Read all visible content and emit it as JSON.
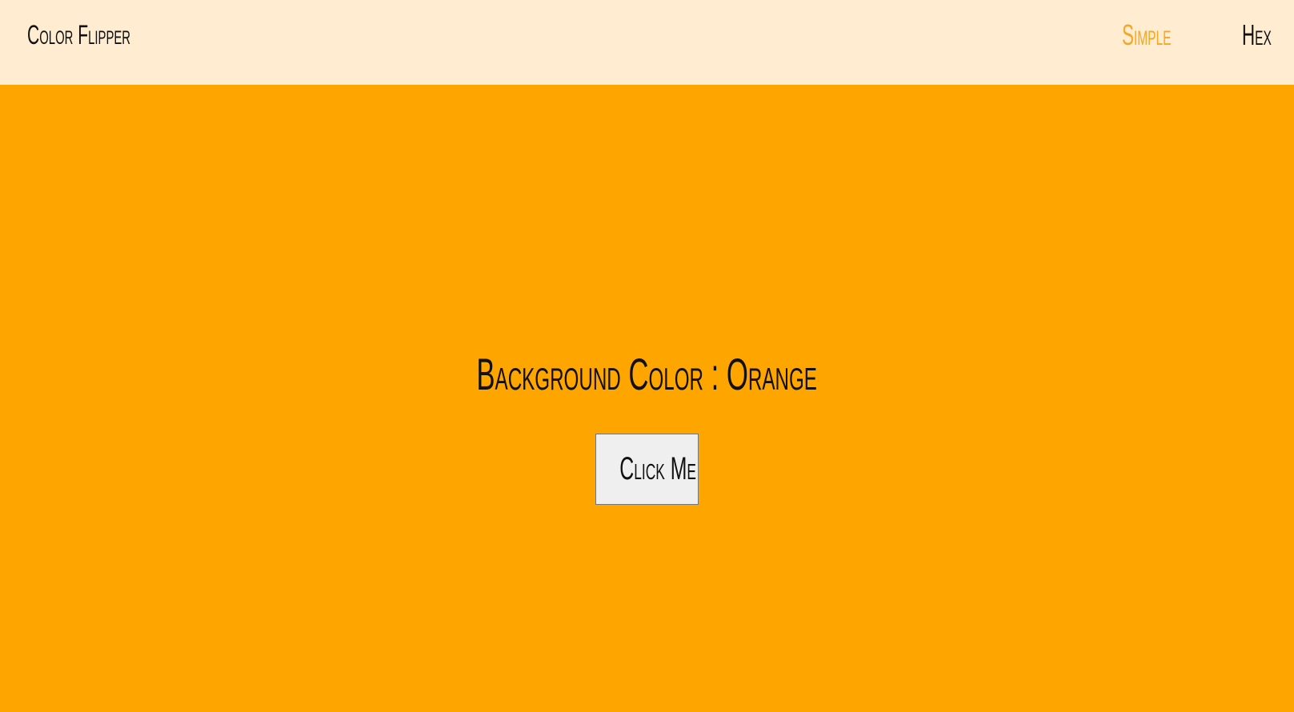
{
  "navbar": {
    "brand": "Color Flipper",
    "links": [
      {
        "label": "Simple",
        "active": true
      },
      {
        "label": "Hex",
        "active": false
      }
    ]
  },
  "main": {
    "heading_prefix": "Background Color : ",
    "color_name": "Orange",
    "button_label": "Click Me"
  },
  "colors": {
    "page_background": "#ffa500",
    "navbar_background": "#ffecd1",
    "active_link": "#f5a623",
    "text": "#111111",
    "button_background": "#efefef"
  }
}
